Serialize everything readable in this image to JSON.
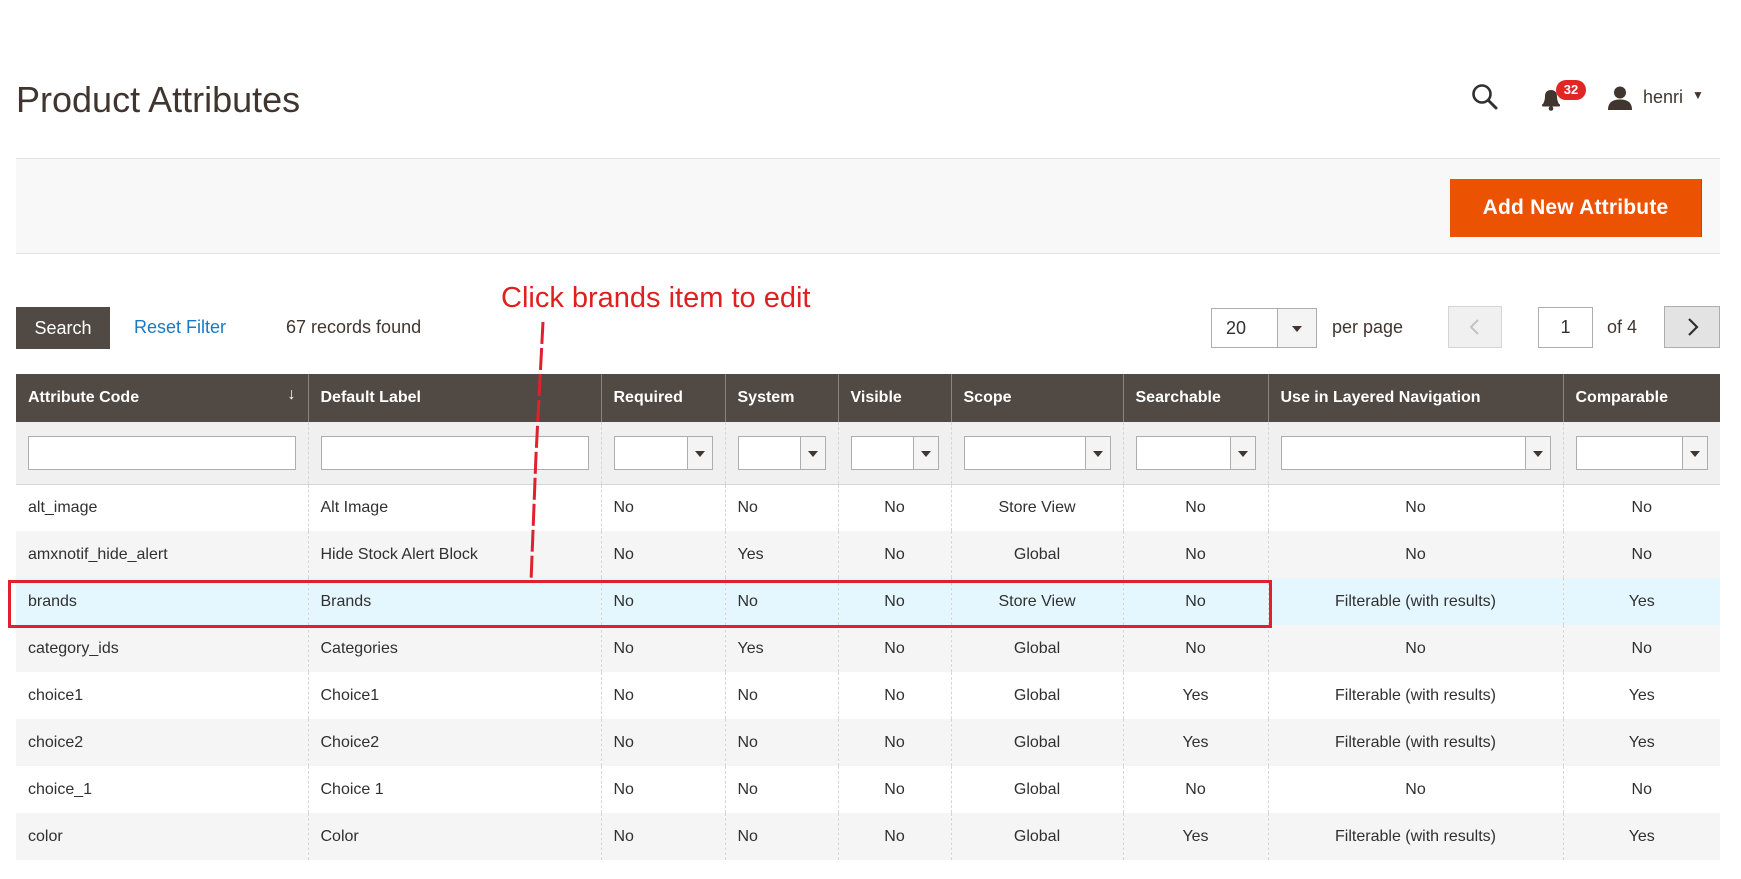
{
  "page": {
    "title": "Product Attributes"
  },
  "header": {
    "notification_count": "32",
    "user_name": "henri"
  },
  "actions": {
    "add_new_label": "Add New Attribute"
  },
  "toolbar": {
    "search_label": "Search",
    "reset_label": "Reset Filter",
    "records_count": "67",
    "records_text": "records found",
    "per_page_value": "20",
    "per_page_label": "per page",
    "current_page": "1",
    "page_total": "of 4"
  },
  "annotation": {
    "text": "Click brands item to edit"
  },
  "table": {
    "columns": [
      "Attribute Code",
      "Default Label",
      "Required",
      "System",
      "Visible",
      "Scope",
      "Searchable",
      "Use in Layered Navigation",
      "Comparable"
    ],
    "rows": [
      [
        "alt_image",
        "Alt Image",
        "No",
        "No",
        "No",
        "Store View",
        "No",
        "No",
        "No"
      ],
      [
        "amxnotif_hide_alert",
        "Hide Stock Alert Block",
        "No",
        "Yes",
        "No",
        "Global",
        "No",
        "No",
        "No"
      ],
      [
        "brands",
        "Brands",
        "No",
        "No",
        "No",
        "Store View",
        "No",
        "Filterable (with results)",
        "Yes"
      ],
      [
        "category_ids",
        "Categories",
        "No",
        "Yes",
        "No",
        "Global",
        "No",
        "No",
        "No"
      ],
      [
        "choice1",
        "Choice1",
        "No",
        "No",
        "No",
        "Global",
        "Yes",
        "Filterable (with results)",
        "Yes"
      ],
      [
        "choice2",
        "Choice2",
        "No",
        "No",
        "No",
        "Global",
        "Yes",
        "Filterable (with results)",
        "Yes"
      ],
      [
        "choice_1",
        "Choice 1",
        "No",
        "No",
        "No",
        "Global",
        "No",
        "No",
        "No"
      ],
      [
        "color",
        "Color",
        "No",
        "No",
        "No",
        "Global",
        "Yes",
        "Filterable (with results)",
        "Yes"
      ]
    ]
  },
  "colors": {
    "accent": "#eb5202",
    "header_bg": "#514943",
    "link": "#1979c3",
    "annotation": "#e02020",
    "highlight_row": "#e5f7fe"
  }
}
